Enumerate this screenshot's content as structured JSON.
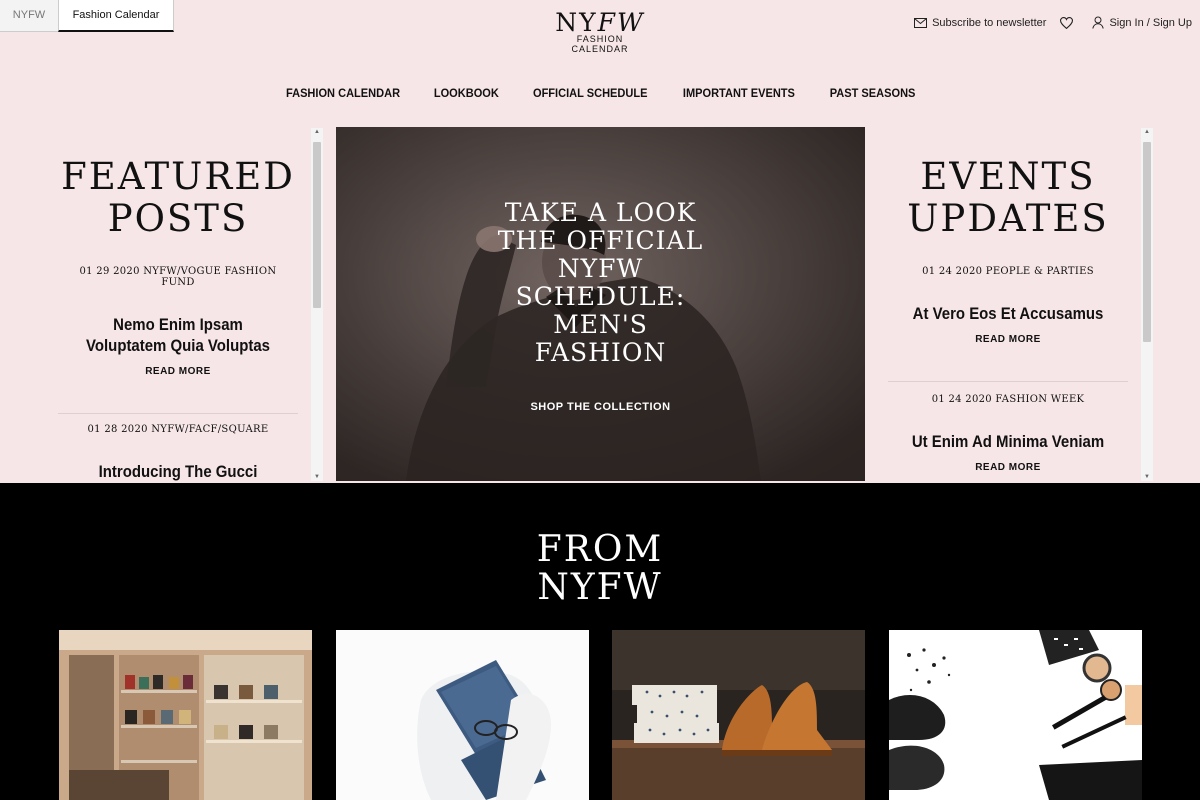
{
  "browser_tabs": [
    {
      "label": "NYFW"
    },
    {
      "label": "Fashion Calendar"
    }
  ],
  "logo": {
    "main_a": "NY",
    "main_b": "FW",
    "sub": "FASHION CALENDAR"
  },
  "header": {
    "newsletter": "Subscribe to newsletter",
    "signin": "Sign In / Sign Up",
    "icons": [
      "envelope-icon",
      "heart-icon",
      "user-icon"
    ]
  },
  "nav": [
    "FASHION CALENDAR",
    "LOOKBOOK",
    "OFFICIAL SCHEDULE",
    "IMPORTANT EVENTS",
    "PAST SEASONS"
  ],
  "featured": {
    "title_line1": "FEATURED",
    "title_line2": "POSTS",
    "posts": [
      {
        "meta": "01 29 2020 NYFW/VOGUE FASHION FUND",
        "title_line1": "Nemo Enim Ipsam",
        "title_line2": "Voluptatem Quia Voluptas",
        "read": "READ MORE"
      },
      {
        "meta": "01 28 2020 NYFW/FACF/SQUARE",
        "title_line1": "Introducing The Gucci",
        "title_line2": "",
        "read": ""
      }
    ]
  },
  "hero": {
    "title_lines": [
      "TAKE A LOOK",
      "THE OFFICIAL",
      "NYFW",
      "SCHEDULE:",
      "MEN'S",
      "FASHION"
    ],
    "cta": "SHOP THE COLLECTION"
  },
  "events": {
    "title_line1": "EVENTS",
    "title_line2": "UPDATES",
    "posts": [
      {
        "meta": "01 24 2020 PEOPLE & PARTIES",
        "title": "At Vero Eos Et Accusamus",
        "read": "READ MORE"
      },
      {
        "meta": "01 24 2020 FASHION WEEK",
        "title": "Ut Enim Ad Minima Veniam",
        "read": "READ MORE"
      }
    ]
  },
  "from_section": {
    "title_line1": "FROM",
    "title_line2": "NYFW"
  },
  "cards": [
    "boutique-photo",
    "folded-clothes-photo",
    "shoes-and-shirts-photo",
    "cosmetics-flatlay-photo"
  ],
  "colors": {
    "page_bg": "#f7e6e7",
    "dark_bg": "#000000",
    "hero_bg": "#4d4340"
  }
}
